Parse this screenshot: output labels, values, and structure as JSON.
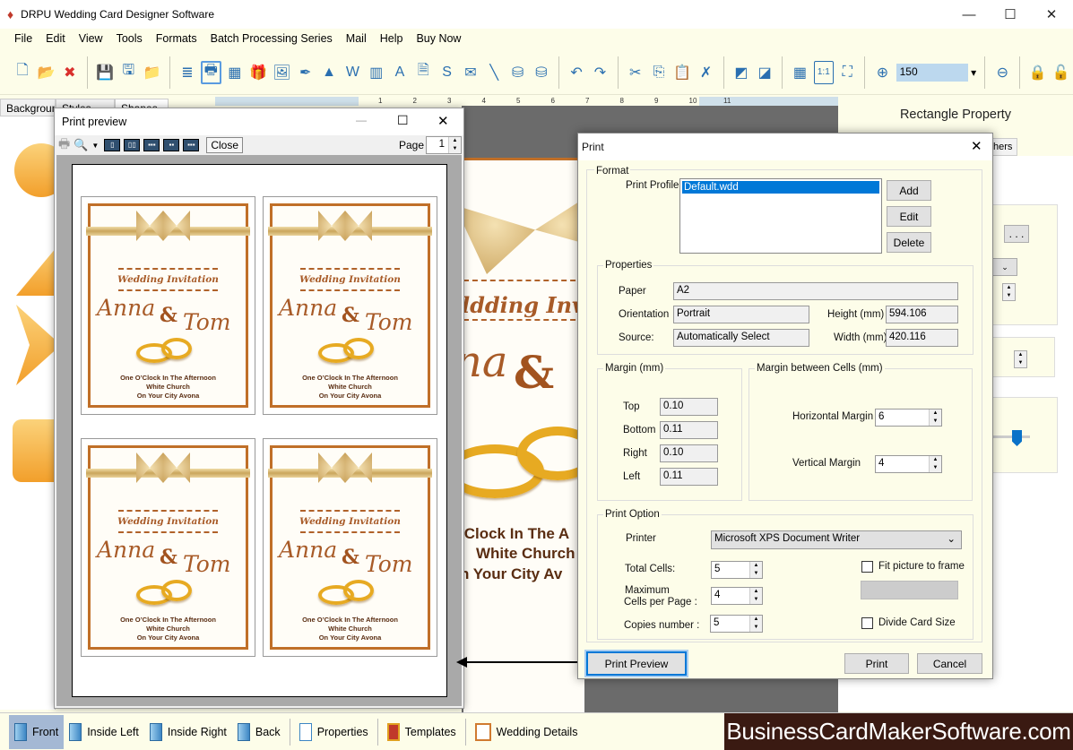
{
  "app": {
    "title": "DRPU Wedding Card Designer Software",
    "window_controls": [
      "minimize-icon",
      "maximize-icon",
      "close-icon"
    ]
  },
  "menu": [
    "File",
    "Edit",
    "View",
    "Tools",
    "Formats",
    "Batch Processing Series",
    "Mail",
    "Help",
    "Buy Now"
  ],
  "toolbar": {
    "groups": [
      [
        "new-icon",
        "open-icon",
        "close-file-icon"
      ],
      [
        "save-icon",
        "save-as-icon",
        "export-icon"
      ],
      [
        "properties-icon",
        "print-icon",
        "background-icon",
        "gift-icon",
        "image-icon",
        "signature-icon",
        "shapes-icon",
        "wordart-icon",
        "barcode-icon",
        "text-icon",
        "text-box-icon",
        "symbol-icon",
        "email-icon",
        "line-icon",
        "database-icon",
        "database-2-icon"
      ],
      [
        "undo-icon",
        "redo-icon"
      ],
      [
        "cut-icon",
        "copy-icon",
        "paste-icon",
        "delete-icon"
      ],
      [
        "bring-front-icon",
        "send-back-icon"
      ],
      [
        "grid-icon",
        "actual-size-icon",
        "fit-window-icon"
      ],
      [
        "zoom-in-icon"
      ],
      [
        "zoom-out-icon"
      ],
      [
        "lock-icon",
        "unlock-icon"
      ]
    ],
    "zoom_value": "150"
  },
  "ruler_labels": [
    "1",
    "2",
    "3",
    "4",
    "5",
    "6",
    "7",
    "8",
    "9",
    "10",
    "11"
  ],
  "left_tabs": [
    "Background",
    "Styles",
    "Shapes"
  ],
  "right_panel": {
    "title": "Rectangle Property",
    "tab_partial": "hers",
    "button": ". . ."
  },
  "print_preview": {
    "title": "Print preview",
    "close_label": "Close",
    "page_label": "Page",
    "page_value": "1"
  },
  "card": {
    "heading": "Wedding Invitation",
    "name1": "Anna",
    "amp": "&",
    "name2": "Tom",
    "line1": "One O’Clock In The Afternoon",
    "line2": "White Church",
    "line3": "On Your City Avona",
    "colors": {
      "frame": "#c06f28",
      "text": "#a85b28",
      "ring": "#e7aa22"
    }
  },
  "canvas_card": {
    "heading": "ldding Invi",
    "line1": "’Clock In The A",
    "line2": "White Church",
    "line3": "n Your City Av"
  },
  "print_dialog": {
    "title": "Print",
    "format_label": "Format",
    "profile_label": "Print Profile",
    "profiles": [
      "Default.wdd"
    ],
    "add": "Add",
    "edit": "Edit",
    "delete": "Delete",
    "properties_label": "Properties",
    "paper_label": "Paper",
    "paper": "A2",
    "orientation_label": "Orientation",
    "orientation": "Portrait",
    "source_label": "Source:",
    "source": "Automatically Select",
    "height_label": "Height (mm)",
    "height": "594.106",
    "width_label": "Width (mm)",
    "width": "420.116",
    "margin_label": "Margin (mm)",
    "top_label": "Top",
    "top": "0.10",
    "bottom_label": "Bottom",
    "bottom": "0.11",
    "right_label": "Right",
    "right": "0.10",
    "left_label": "Left",
    "left": "0.11",
    "cell_margin_label": "Margin between Cells (mm)",
    "hmargin_label": "Horizontal Margin",
    "hmargin": "6",
    "vmargin_label": "Vertical Margin",
    "vmargin": "4",
    "print_option_label": "Print Option",
    "printer_label": "Printer",
    "printer": "Microsoft XPS Document Writer",
    "total_cells_label": "Total Cells:",
    "total_cells": "5",
    "max_cells_label1": "Maximum",
    "max_cells_label2": "Cells per Page :",
    "max_cells": "4",
    "copies_label": "Copies number :",
    "copies": "5",
    "fit_label": "Fit picture to frame",
    "fit_checked": false,
    "divide_label": "Divide Card Size",
    "divide_checked": false,
    "preview_btn": "Print Preview",
    "print_btn": "Print",
    "cancel_btn": "Cancel"
  },
  "bottom_tabs": [
    {
      "label": "Front",
      "active": true
    },
    {
      "label": "Inside Left"
    },
    {
      "label": "Inside Right"
    },
    {
      "label": "Back"
    },
    {
      "label": "Properties"
    },
    {
      "label": "Templates"
    },
    {
      "label": "Wedding Details"
    }
  ],
  "watermark": "BusinessCardMakerSoftware.com"
}
